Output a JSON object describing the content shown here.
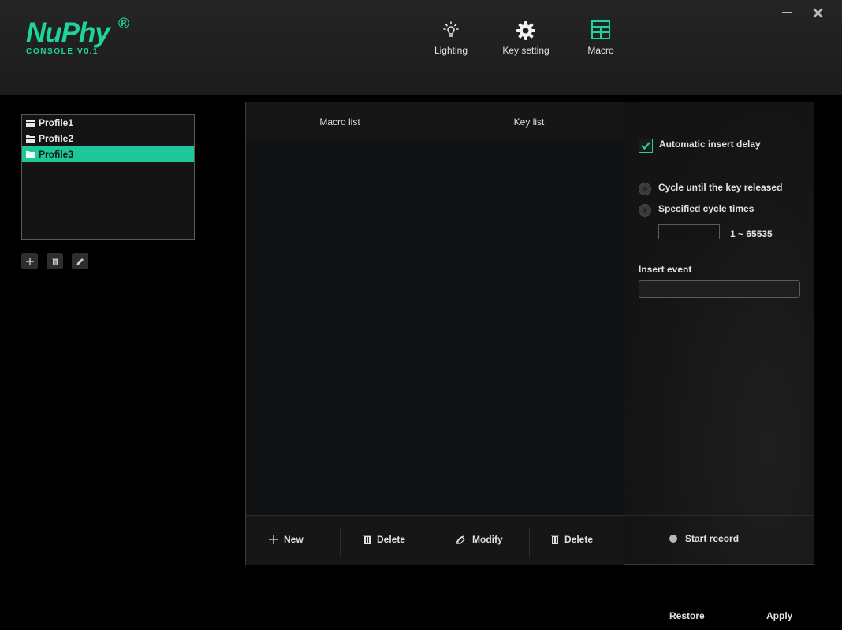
{
  "app": {
    "logo_text": "NuPhy",
    "logo_registered": "®",
    "logo_subtitle": "CONSOLE V0.1",
    "brand_color": "#1ed49c"
  },
  "window_controls": {
    "minimize_icon": "minimize-icon",
    "close_icon": "close-icon"
  },
  "nav": {
    "tabs": [
      {
        "label": "Lighting",
        "icon": "lightbulb-icon"
      },
      {
        "label": "Key setting",
        "icon": "gear-icon"
      },
      {
        "label": "Macro",
        "icon": "grid-icon",
        "active": true
      }
    ]
  },
  "profiles": {
    "items": [
      {
        "label": "Profile1"
      },
      {
        "label": "Profile2"
      },
      {
        "label": "Profile3",
        "selected": true
      }
    ],
    "selected_color": "#1ec79a",
    "tools": [
      "add-icon",
      "trash-icon",
      "pencil-icon"
    ]
  },
  "macro": {
    "macro_list_header": "Macro list",
    "key_list_header": "Key list",
    "new_label": "New",
    "delete_label": "Delete",
    "modify_label": "Modify",
    "key_delete_label": "Delete"
  },
  "options": {
    "auto_delay_label": "Automatic insert delay",
    "auto_delay_checked": true,
    "cycle_release_label": "Cycle until the key released",
    "cycle_times_label": "Specified cycle times",
    "cycle_times_value": "",
    "cycle_range_label": "1 ~ 65535",
    "insert_event_label": "Insert event",
    "insert_event_value": "",
    "start_record_label": "Start record"
  },
  "footer": {
    "restore_label": "Restore",
    "apply_label": "Apply"
  }
}
